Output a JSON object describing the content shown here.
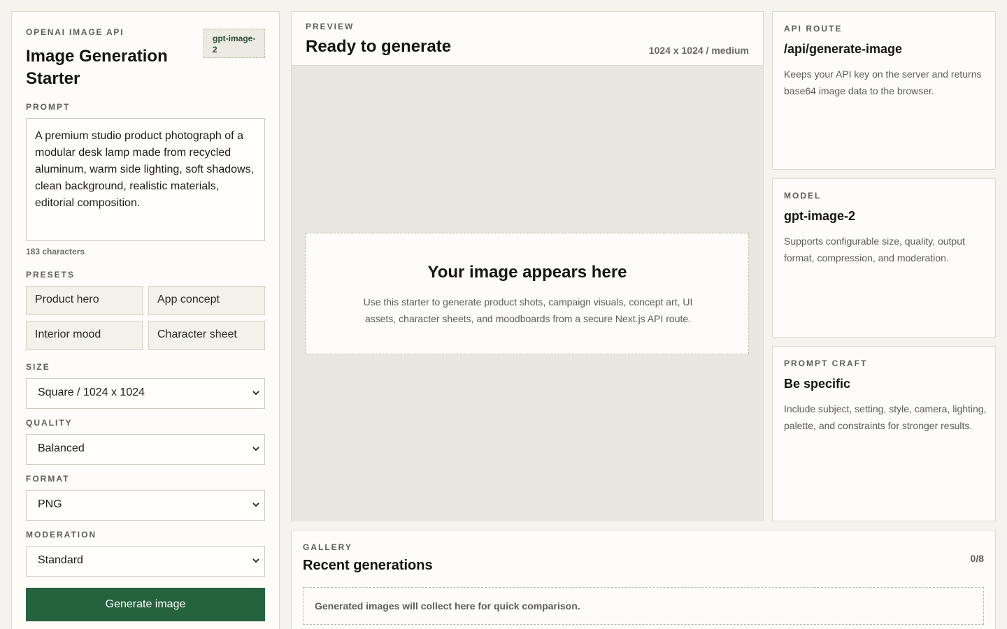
{
  "sidebar": {
    "eyebrow": "OPENAI IMAGE API",
    "title": "Image Generation Starter",
    "model_badge": "gpt-image-2",
    "prompt_label": "PROMPT",
    "prompt_value": "A premium studio product photograph of a modular desk lamp made from recycled aluminum, warm side lighting, soft shadows, clean background, realistic materials, editorial composition.",
    "char_count": "183 characters",
    "presets_label": "PRESETS",
    "presets": [
      "Product hero",
      "App concept",
      "Interior mood",
      "Character sheet"
    ],
    "size_label": "SIZE",
    "size_value": "Square / 1024 x 1024",
    "quality_label": "QUALITY",
    "quality_value": "Balanced",
    "format_label": "FORMAT",
    "format_value": "PNG",
    "moderation_label": "MODERATION",
    "moderation_value": "Standard",
    "generate_label": "Generate image"
  },
  "preview": {
    "eyebrow": "PREVIEW",
    "title": "Ready to generate",
    "meta": "1024 x 1024 / medium",
    "empty_title": "Your image appears here",
    "empty_desc": "Use this starter to generate product shots, campaign visuals, concept art, UI assets, character sheets, and moodboards from a secure Next.js API route."
  },
  "cards": [
    {
      "eyebrow": "API ROUTE",
      "title": "/api/generate-image",
      "desc": "Keeps your API key on the server and returns base64 image data to the browser."
    },
    {
      "eyebrow": "MODEL",
      "title": "gpt-image-2",
      "desc": "Supports configurable size, quality, output format, compression, and moderation."
    },
    {
      "eyebrow": "PROMPT CRAFT",
      "title": "Be specific",
      "desc": "Include subject, setting, style, camera, lighting, palette, and constraints for stronger results."
    }
  ],
  "gallery": {
    "eyebrow": "GALLERY",
    "title": "Recent generations",
    "count": "0/8",
    "empty": "Generated images will collect here for quick comparison."
  },
  "colors": {
    "background": "#f4f3ee",
    "panel": "#fdfcf8",
    "accent": "#25623e",
    "canvas": "#e9e6df"
  },
  "icons": {
    "select_chevron": "chevron-down-icon"
  }
}
